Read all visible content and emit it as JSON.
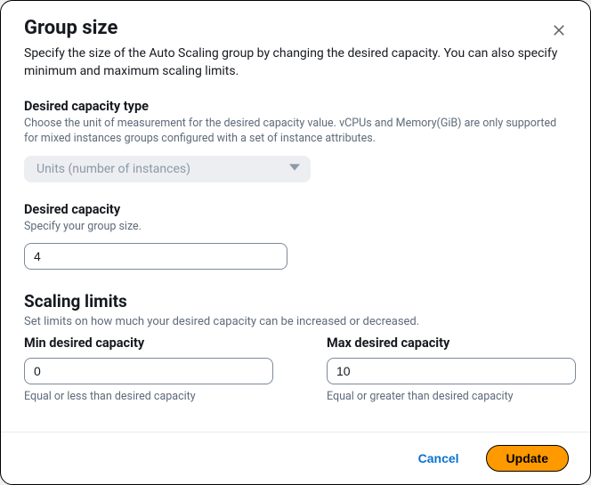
{
  "header": {
    "title": "Group size",
    "subtitle": "Specify the size of the Auto Scaling group by changing the desired capacity. You can also specify minimum and maximum scaling limits."
  },
  "capacity_type": {
    "label": "Desired capacity type",
    "helper": "Choose the unit of measurement for the desired capacity value. vCPUs and Memory(GiB) are only supported for mixed instances groups configured with a set of instance attributes.",
    "selected": "Units (number of instances)"
  },
  "desired": {
    "label": "Desired capacity",
    "helper": "Specify your group size.",
    "value": "4"
  },
  "scaling": {
    "title": "Scaling limits",
    "subtitle": "Set limits on how much your desired capacity can be increased or decreased.",
    "min": {
      "label": "Min desired capacity",
      "value": "0",
      "hint": "Equal or less than desired capacity"
    },
    "max": {
      "label": "Max desired capacity",
      "value": "10",
      "hint": "Equal or greater than desired capacity"
    }
  },
  "footer": {
    "cancel": "Cancel",
    "update": "Update"
  }
}
